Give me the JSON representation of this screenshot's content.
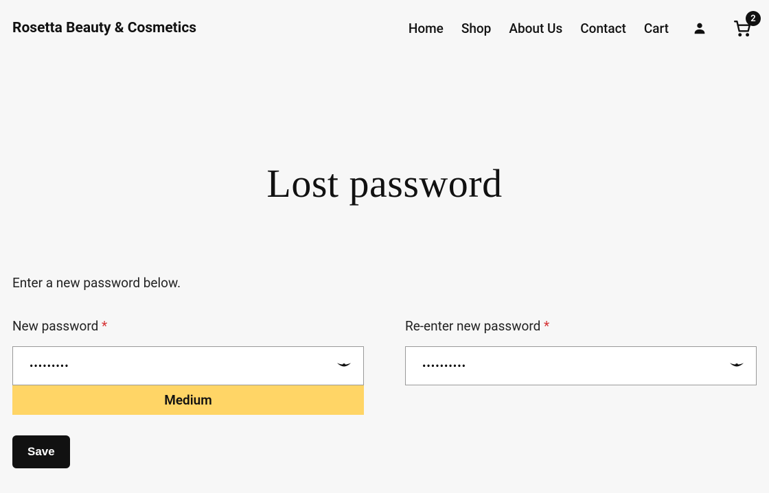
{
  "site": {
    "title": "Rosetta Beauty & Cosmetics"
  },
  "nav": {
    "items": [
      {
        "label": "Home"
      },
      {
        "label": "Shop"
      },
      {
        "label": "About Us"
      },
      {
        "label": "Contact"
      },
      {
        "label": "Cart"
      }
    ],
    "cart_count": "2"
  },
  "page": {
    "title": "Lost password",
    "instructions": "Enter a new password below."
  },
  "form": {
    "new_password": {
      "label": "New password ",
      "value": "•••••••••",
      "strength": "Medium"
    },
    "confirm_password": {
      "label": "Re-enter new password ",
      "value": "••••••••••"
    },
    "required_marker": "*",
    "submit_label": "Save"
  }
}
